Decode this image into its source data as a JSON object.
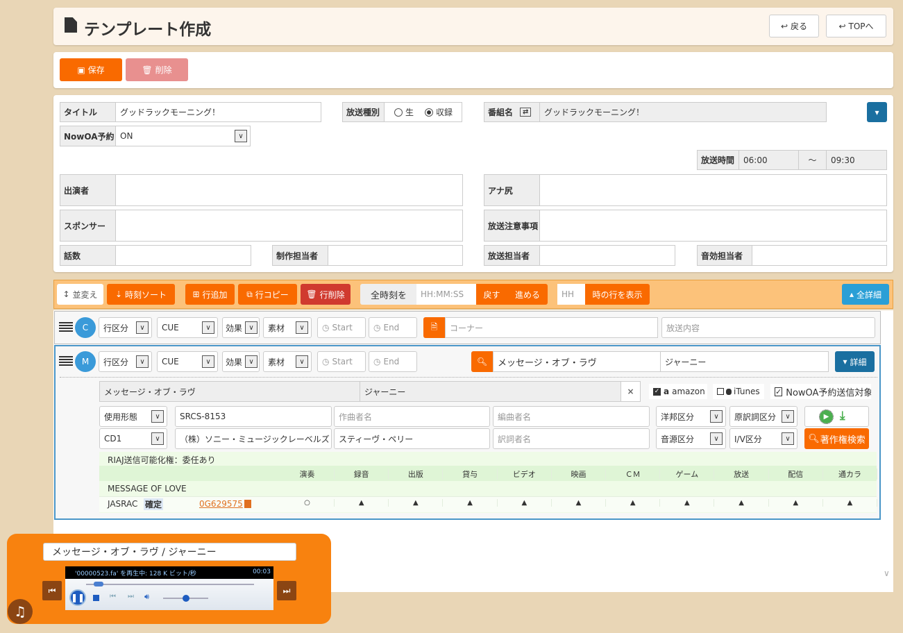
{
  "header": {
    "title": "テンプレート作成",
    "back": "戻る",
    "top": "TOPへ"
  },
  "actions": {
    "save": "保存",
    "delete": "削除"
  },
  "form": {
    "title_label": "タイトル",
    "title_value": "グッドラックモーニング！",
    "broadcast_type_label": "放送種別",
    "radio_live": "生",
    "radio_recorded": "収録",
    "radio_selected": "収録",
    "program_label": "番組名",
    "program_value": "グッドラックモーニング！",
    "nowoa_label": "NowOA予約",
    "nowoa_value": "ON",
    "airtime_label": "放送時間",
    "start": "06:00",
    "tilde": "〜",
    "end": "09:30",
    "cast_label": "出演者",
    "ana_label": "アナ尻",
    "sponsor_label": "スポンサー",
    "notes_label": "放送注意事項",
    "episode_label": "話数",
    "producer_label": "制作担当者",
    "broadcast_staff_label": "放送担当者",
    "sound_staff_label": "音効担当者"
  },
  "toolbar": {
    "reorder": "並変え",
    "time_sort": "時刻ソート",
    "add_row": "行追加",
    "copy_row": "行コピー",
    "delete_row": "行削除",
    "all_time": "全時刻を",
    "time_placeholder": "HH:MM:SS",
    "back": "戻す",
    "forward": "進める",
    "hour_placeholder": "HH",
    "show_hour": "時の行を表示",
    "all_detail": "全詳細"
  },
  "rows": [
    {
      "badge": "C",
      "row_type": "行区分",
      "cue": "CUE",
      "effect": "効果",
      "material": "素材",
      "start_ph": "Start",
      "end_ph": "End",
      "corner_ph": "コーナー",
      "content_ph": "放送内容"
    },
    {
      "badge": "M",
      "row_type": "行区分",
      "cue": "CUE",
      "effect": "効果",
      "material": "素材",
      "start_ph": "Start",
      "end_ph": "End",
      "song": "メッセージ・オブ・ラヴ",
      "artist": "ジャーニー",
      "detail": "詳細"
    }
  ],
  "detail": {
    "song": "メッセージ・オブ・ラヴ",
    "artist": "ジャーニー",
    "clear": "×",
    "amazon": "amazon",
    "amazon_checked": true,
    "itunes": "iTunes",
    "itunes_checked": false,
    "nowoa_send": "NowOA予約送信対象",
    "nowoa_checked": true,
    "usage": "使用形態",
    "catalog": "SRCS-8153",
    "composer_ph": "作曲者名",
    "arranger_ph": "編曲者名",
    "origin": "洋邦区分",
    "translation": "原訳詞区分",
    "media": "CD1",
    "label": "（株）ソニー・ミュージックレーベルズ",
    "lyricist": "スティーヴ・ペリー",
    "translator_ph": "訳詞者名",
    "source": "音源区分",
    "iv": "I/V区分",
    "copyright_search": "著作権検索",
    "riaj": "RIAJ送信可能化権：委任あり",
    "columns": [
      "演奏",
      "録音",
      "出版",
      "貸与",
      "ビデオ",
      "映画",
      "ＣＭ",
      "ゲーム",
      "放送",
      "配信",
      "通カラ"
    ],
    "original_title": "MESSAGE OF LOVE",
    "society": "JASRAC",
    "status": "確定",
    "code": "0G629575",
    "marks": [
      "○",
      "▲",
      "▲",
      "▲",
      "▲",
      "▲",
      "▲",
      "▲",
      "▲",
      "▲",
      "▲"
    ]
  },
  "player": {
    "now_playing": "メッセージ・オブ・ラヴ / ジャーニー",
    "status": "'00000523.fa' を再生中: 128 K ビット/秒",
    "time": "00:03",
    "progress": 0.05,
    "volume": 0.5
  },
  "colors": {
    "orange": "#f96a00",
    "red": "#d03a2f",
    "blue": "#1a6fa0",
    "background": "#e9d6b6"
  }
}
